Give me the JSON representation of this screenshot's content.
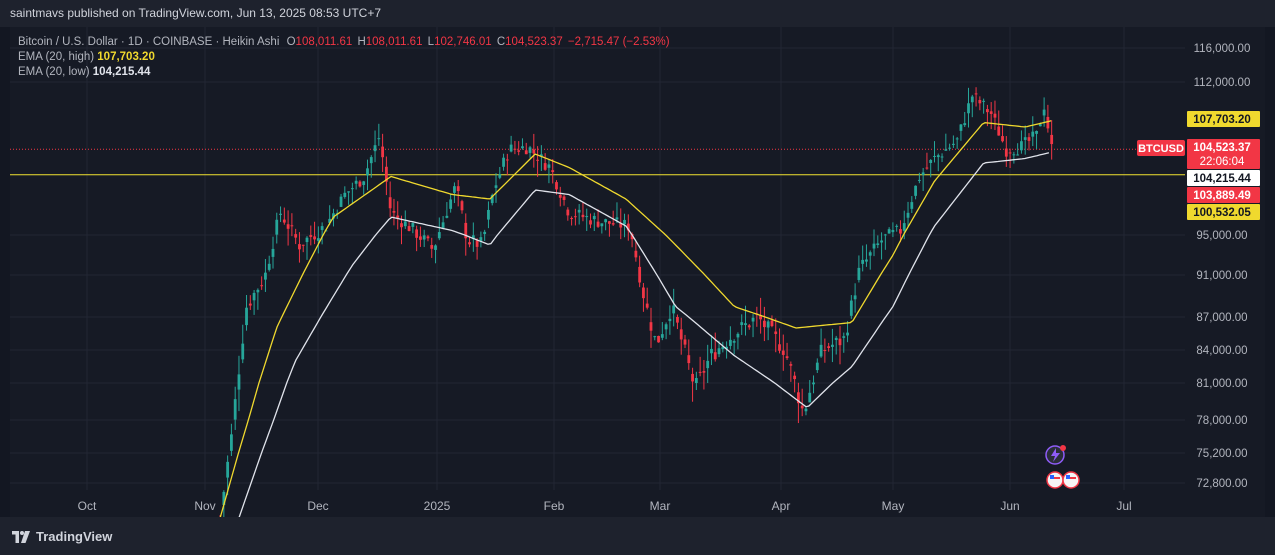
{
  "header": {
    "publish_line": "saintmavs published on TradingView.com, Jun 13, 2025 08:53 UTC+7"
  },
  "legend": {
    "symbol": "Bitcoin / U.S. Dollar · 1D · COINBASE · Heikin Ashi",
    "open_key": "O",
    "open": "108,011.61",
    "high_key": "H",
    "high": "108,011.61",
    "low_key": "L",
    "low": "102,746.01",
    "close_key": "C",
    "close": "104,523.37",
    "change": "−2,715.47 (−2.53%)",
    "ema_high_name": "EMA (20, high)",
    "ema_high_value": "107,703.20",
    "ema_low_name": "EMA (20, low)",
    "ema_low_value": "104,215.44"
  },
  "footer": {
    "brand": "TradingView"
  },
  "colors": {
    "up": "#26a69a",
    "down": "#f23645",
    "ema_high": "#f0d92e",
    "ema_low": "#e0e3eb",
    "level_line": "#f0e130",
    "grid": "#222633"
  },
  "chart_data": {
    "type": "candlestick",
    "x": [
      "Oct",
      "Nov",
      "Dec",
      "2025",
      "Feb",
      "Mar",
      "Apr",
      "May",
      "Jun",
      "Jul"
    ],
    "y_ticks": [
      116000,
      112000,
      95000,
      91000,
      87000,
      84000,
      81000,
      78000,
      75200,
      72800
    ],
    "y_tick_labels": [
      "116,000.00",
      "112,000.00",
      "95,000.00",
      "91,000.00",
      "87,000.00",
      "84,000.00",
      "81,000.00",
      "78,000.00",
      "75,200.00",
      "72,800.00"
    ],
    "horizontal_level": 101700,
    "price_tags": [
      {
        "label": "107,703.20",
        "value": 107703.2,
        "bg": "#f0d92e",
        "fg": "#131722"
      },
      {
        "label": "BTCUSD",
        "value": 104523.37,
        "bg": "#f23645",
        "fg": "#ffffff",
        "side": "left"
      },
      {
        "label": "104,523.37",
        "value": 104523.37,
        "bg": "#f23645",
        "fg": "#ffffff"
      },
      {
        "label": "22:06:04",
        "value": 104523.37,
        "bg": "#f23645",
        "fg": "#ffffff",
        "sub": true
      },
      {
        "label": "104,215.44",
        "value": 104215.44,
        "bg": "#ffffff",
        "fg": "#131722"
      },
      {
        "label": "103,889.49",
        "value": 103889.49,
        "bg": "#f23645",
        "fg": "#ffffff"
      },
      {
        "label": "100,532.05",
        "value": 100532.05,
        "bg": "#f0d92e",
        "fg": "#131722"
      }
    ],
    "series_keypoints": {
      "close": [
        [
          "Nov 05",
          70000
        ],
        [
          "Nov 08",
          76500
        ],
        [
          "Nov 12",
          88000
        ],
        [
          "Nov 17",
          91000
        ],
        [
          "Nov 21",
          97500
        ],
        [
          "Nov 26",
          94000
        ],
        [
          "Dec 03",
          96000
        ],
        [
          "Dec 08",
          99500
        ],
        [
          "Dec 13",
          101500
        ],
        [
          "Dec 17",
          106000
        ],
        [
          "Dec 20",
          97500
        ],
        [
          "Dec 26",
          95500
        ],
        [
          "Dec 31",
          93500
        ],
        [
          "Jan 06",
          100500
        ],
        [
          "Jan 09",
          94500
        ],
        [
          "Jan 13",
          94000
        ],
        [
          "Jan 16",
          100000
        ],
        [
          "Jan 20",
          104500
        ],
        [
          "Jan 25",
          104800
        ],
        [
          "Jan 31",
          102500
        ],
        [
          "Feb 05",
          97500
        ],
        [
          "Feb 13",
          96500
        ],
        [
          "Feb 21",
          96000
        ],
        [
          "Feb 25",
          88500
        ],
        [
          "Feb 28",
          84500
        ],
        [
          "Mar 04",
          88000
        ],
        [
          "Mar 10",
          80500
        ],
        [
          "Mar 14",
          83500
        ],
        [
          "Mar 20",
          85500
        ],
        [
          "Mar 26",
          87000
        ],
        [
          "Apr 02",
          84000
        ],
        [
          "Apr 07",
          78500
        ],
        [
          "Apr 12",
          84000
        ],
        [
          "Apr 18",
          85000
        ],
        [
          "Apr 22",
          91500
        ],
        [
          "Apr 28",
          94500
        ],
        [
          "May 03",
          95500
        ],
        [
          "May 08",
          101500
        ],
        [
          "May 12",
          103500
        ],
        [
          "May 18",
          105500
        ],
        [
          "May 22",
          110500
        ],
        [
          "May 27",
          108500
        ],
        [
          "May 31",
          104500
        ],
        [
          "Jun 04",
          104800
        ],
        [
          "Jun 08",
          106000
        ],
        [
          "Jun 10",
          109500
        ],
        [
          "Jun 12",
          104523
        ]
      ],
      "ema_high": [
        [
          "Nov 05",
          70000
        ],
        [
          "Nov 20",
          86000
        ],
        [
          "Dec 05",
          97000
        ],
        [
          "Dec 20",
          101500
        ],
        [
          "Jan 05",
          99500
        ],
        [
          "Jan 15",
          99000
        ],
        [
          "Jan 27",
          104000
        ],
        [
          "Feb 05",
          102500
        ],
        [
          "Feb 20",
          99000
        ],
        [
          "Mar 05",
          94000
        ],
        [
          "Mar 20",
          88000
        ],
        [
          "Apr 05",
          86000
        ],
        [
          "Apr 20",
          86500
        ],
        [
          "May 01",
          93000
        ],
        [
          "May 12",
          101000
        ],
        [
          "May 25",
          107500
        ],
        [
          "Jun 05",
          107000
        ],
        [
          "Jun 12",
          107703
        ]
      ],
      "ema_low": [
        [
          "Nov 10",
          70000
        ],
        [
          "Nov 25",
          83000
        ],
        [
          "Dec 10",
          92000
        ],
        [
          "Dec 20",
          97000
        ],
        [
          "Jan 05",
          95500
        ],
        [
          "Jan 15",
          94000
        ],
        [
          "Jan 27",
          100000
        ],
        [
          "Feb 05",
          99500
        ],
        [
          "Feb 20",
          96000
        ],
        [
          "Mar 05",
          88000
        ],
        [
          "Mar 20",
          83500
        ],
        [
          "Apr 08",
          79000
        ],
        [
          "Apr 20",
          82500
        ],
        [
          "May 01",
          88000
        ],
        [
          "May 12",
          96000
        ],
        [
          "May 25",
          103000
        ],
        [
          "Jun 05",
          103500
        ],
        [
          "Jun 12",
          104215
        ]
      ]
    }
  }
}
